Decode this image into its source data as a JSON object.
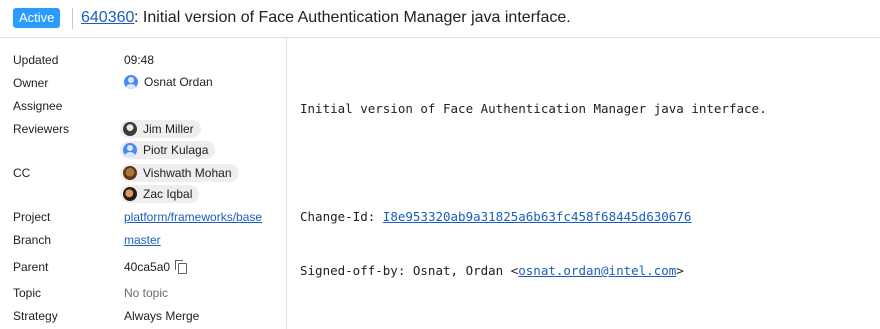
{
  "header": {
    "status": "Active",
    "change_number": "640360",
    "subject": ": Initial version of Face Authentication Manager java interface."
  },
  "meta": {
    "updated": {
      "label": "Updated",
      "value": "09:48"
    },
    "owner": {
      "label": "Owner",
      "name": "Osnat Ordan"
    },
    "assignee": {
      "label": "Assignee"
    },
    "reviewers": {
      "label": "Reviewers",
      "people": [
        "Jim Miller",
        "Piotr Kulaga"
      ]
    },
    "cc": {
      "label": "CC",
      "people": [
        "Vishwath Mohan",
        "Zac Iqbal"
      ]
    },
    "project": {
      "label": "Project",
      "value": "platform/frameworks/base"
    },
    "branch": {
      "label": "Branch",
      "value": "master"
    },
    "parent": {
      "label": "Parent",
      "value": "40ca5a0"
    },
    "topic": {
      "label": "Topic",
      "value": "No topic"
    },
    "strategy": {
      "label": "Strategy",
      "value": "Always Merge"
    }
  },
  "commit_message": {
    "title": "Initial version of Face Authentication Manager java interface.",
    "change_id_label": "Change-Id: ",
    "change_id": "I8e953320ab9a31825a6b63fc458f68445d630676",
    "signed_off_label": "Signed-off-by: Osnat, Ordan <",
    "signed_off_email": "osnat.ordan@intel.com",
    "signed_off_suffix": ">"
  },
  "icons": {
    "copy": "copy-icon",
    "avatar_default": "person-avatar-icon"
  },
  "colors": {
    "status_chip": "#2b9cff",
    "link": "#1a5ebd"
  }
}
